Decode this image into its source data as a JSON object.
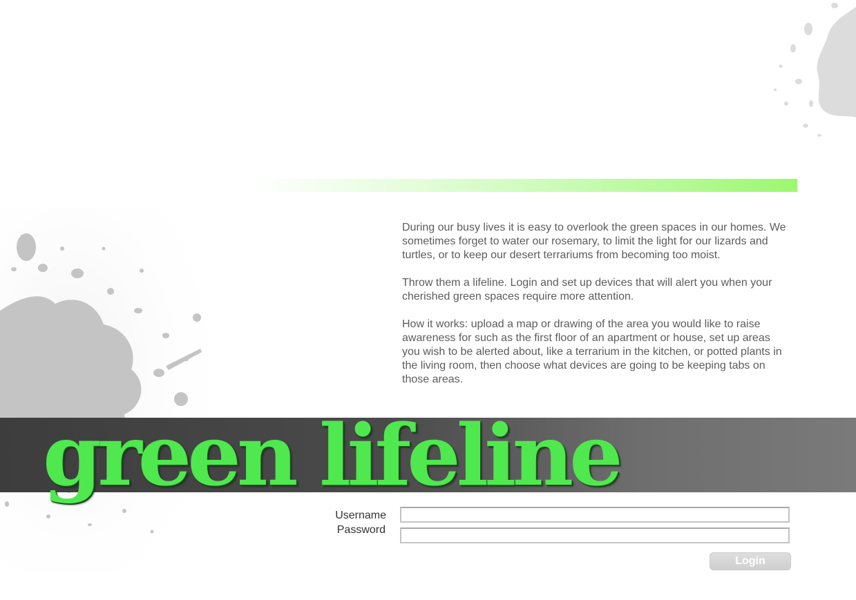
{
  "intro": {
    "paragraphs": [
      "During our busy lives it is easy to overlook the green spaces in our homes. We sometimes forget to water our rosemary, to limit the light for our lizards and turtles, or to keep our desert terrariums from becoming too moist.",
      "Throw them a lifeline. Login and set up devices that will alert you when your cherished green spaces require more attention.",
      "How it works: upload a map or drawing of the area you would like to raise awareness for such as the first floor of an apartment or house, set up areas you wish to be alerted about, like a terrarium in the kitchen, or potted plants in the living room, then choose what devices are going to be keeping tabs on those areas."
    ]
  },
  "brand": {
    "title": "green lifeline"
  },
  "login": {
    "username_label": "Username",
    "username_value": "",
    "password_label": "Password",
    "password_value": "",
    "button_label": "Login"
  },
  "colors": {
    "brand_green": "#4fe84f",
    "accent_green": "#9cf870",
    "banner_dark": "#3d3d3d",
    "body_text": "#5c5c5c",
    "button_grey": "#d4d4d4"
  }
}
